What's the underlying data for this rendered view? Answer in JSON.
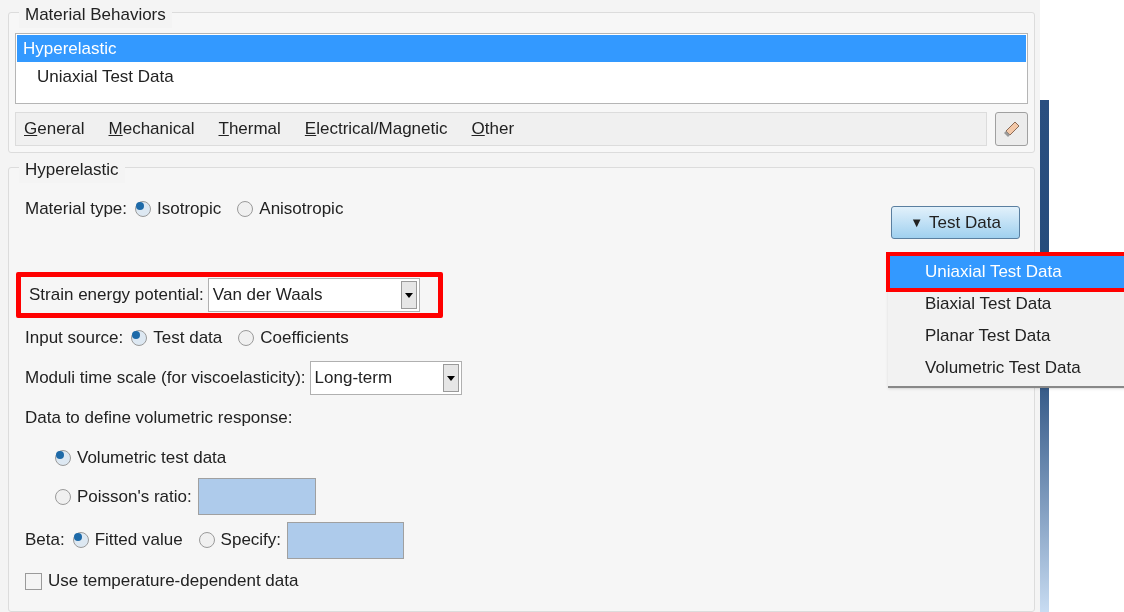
{
  "behaviors": {
    "title": "Material Behaviors",
    "items": [
      {
        "label": "Hyperelastic",
        "selected": true,
        "children": [
          {
            "label": "Uniaxial Test Data",
            "selected": false
          }
        ]
      }
    ],
    "menus": [
      {
        "mnemonic": "G",
        "rest": "eneral"
      },
      {
        "mnemonic": "M",
        "rest": "echanical"
      },
      {
        "mnemonic": "T",
        "rest": "hermal"
      },
      {
        "mnemonic": "E",
        "rest": "lectrical/Magnetic"
      },
      {
        "mnemonic": "O",
        "rest": "ther"
      }
    ]
  },
  "hyperelastic": {
    "title": "Hyperelastic",
    "material_type": {
      "label": "Material type:",
      "options": [
        {
          "label": "Isotropic",
          "selected": true
        },
        {
          "label": "Anisotropic",
          "selected": false
        }
      ]
    },
    "test_data_button": {
      "icon": "▼",
      "label": "Test Data",
      "expanded": true,
      "menu": [
        {
          "label": "Uniaxial Test Data",
          "selected": true,
          "highlighted": true
        },
        {
          "label": "Biaxial Test Data",
          "selected": false,
          "highlighted": false
        },
        {
          "label": "Planar Test Data",
          "selected": false,
          "highlighted": false
        },
        {
          "label": "Volumetric Test Data",
          "selected": false,
          "highlighted": false
        }
      ]
    },
    "strain_energy": {
      "label": "Strain energy potential:",
      "value": "Van der Waals",
      "highlighted": true
    },
    "input_source": {
      "label": "Input source:",
      "options": [
        {
          "label": "Test data",
          "selected": true
        },
        {
          "label": "Coefficients",
          "selected": false
        }
      ]
    },
    "moduli": {
      "label": "Moduli time scale (for viscoelasticity):",
      "value": "Long-term"
    },
    "volumetric": {
      "label": "Data to define volumetric response:",
      "options": [
        {
          "label": "Volumetric test data",
          "selected": true,
          "kind": "plain"
        },
        {
          "label": "Poisson's ratio:",
          "selected": false,
          "kind": "field"
        }
      ]
    },
    "beta": {
      "label": "Beta:",
      "options": [
        {
          "label": "Fitted value",
          "selected": true,
          "kind": "plain"
        },
        {
          "label": "Specify:",
          "selected": false,
          "kind": "field"
        }
      ]
    },
    "temperature": {
      "label": "Use temperature-dependent data",
      "checked": false
    }
  }
}
